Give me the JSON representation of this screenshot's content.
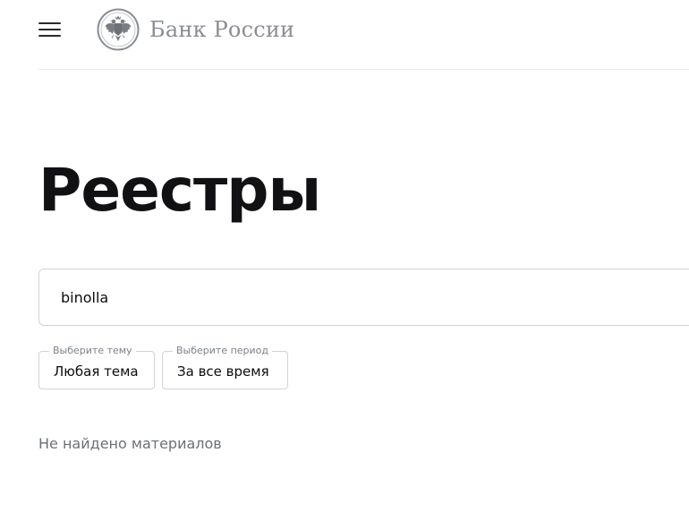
{
  "header": {
    "menu_icon": "hamburger-menu-icon",
    "logo_icon": "double-headed-eagle-emblem-icon",
    "logo_text": "Банк России"
  },
  "main": {
    "title": "Реестры",
    "search": {
      "value": "binolla",
      "placeholder": ""
    },
    "filters": {
      "topic": {
        "legend": "Выберите тему",
        "value": "Любая тема"
      },
      "period": {
        "legend": "Выберите период",
        "value": "За все время"
      }
    },
    "empty_message": "Не найдено материалов"
  },
  "colors": {
    "text_primary": "#0c0c0e",
    "text_secondary": "#6b7079",
    "logo_gray": "#8a8e94",
    "border": "#cfd3d8",
    "divider": "#e9ebee"
  }
}
